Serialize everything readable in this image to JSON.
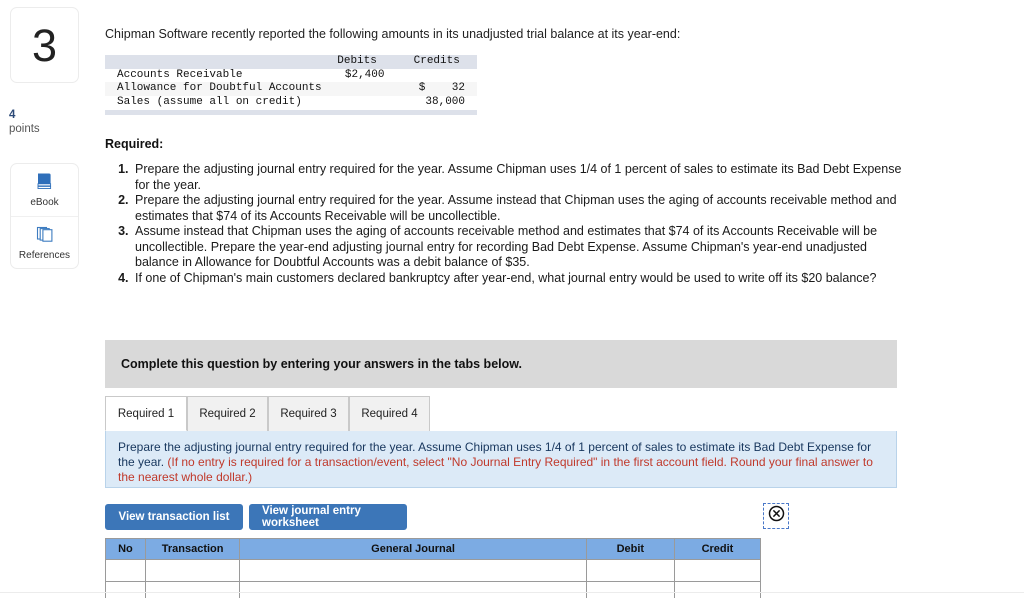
{
  "sidebar": {
    "question_number": "3",
    "points_value": "4",
    "points_label": "points",
    "tools": [
      {
        "label": "eBook",
        "icon": "book-icon"
      },
      {
        "label": "References",
        "icon": "pages-icon"
      }
    ]
  },
  "main": {
    "intro": "Chipman Software recently reported the following amounts in its unadjusted trial balance at its year-end:",
    "trial_balance": {
      "columns": [
        "",
        "Debits",
        "Credits"
      ],
      "rows": [
        {
          "account": "Accounts Receivable",
          "debit": "$2,400",
          "credit_symbol": "",
          "credit": ""
        },
        {
          "account": "Allowance for Doubtful Accounts",
          "debit": "",
          "credit_symbol": "$",
          "credit": "32"
        },
        {
          "account": "Sales (assume all on credit)",
          "debit": "",
          "credit_symbol": "",
          "credit": "38,000"
        }
      ]
    },
    "required_heading": "Required:",
    "required_items": [
      "Prepare the adjusting journal entry required for the year. Assume Chipman uses 1/4 of 1 percent of sales to estimate its Bad Debt Expense for the year.",
      "Prepare the adjusting journal entry required for the year. Assume instead that Chipman uses the aging of accounts receivable method and estimates that $74 of its Accounts Receivable will be uncollectible.",
      "Assume instead that Chipman uses the aging of accounts receivable method and estimates that $74 of its Accounts Receivable will be uncollectible. Prepare the year-end adjusting journal entry for recording Bad Debt Expense. Assume Chipman's year-end unadjusted balance in Allowance for Doubtful Accounts was a debit balance of $35.",
      "If one of Chipman's main customers declared bankruptcy after year-end, what journal entry would be used to write off its $20 balance?"
    ],
    "banner_text": "Complete this question by entering your answers in the tabs below.",
    "tabs": [
      {
        "label": "Required 1",
        "active": true
      },
      {
        "label": "Required 2",
        "active": false
      },
      {
        "label": "Required 3",
        "active": false
      },
      {
        "label": "Required 4",
        "active": false
      }
    ],
    "instruction": {
      "main": "Prepare the adjusting journal entry required for the year. Assume Chipman uses 1/4 of 1 percent of sales to estimate its Bad Debt Expense for the year. ",
      "note": "(If no entry is required for a transaction/event, select \"No Journal Entry Required\" in the first account field. Round your final answer to the nearest whole dollar.)"
    },
    "buttons": {
      "transaction_list": "View transaction list",
      "journal_worksheet": "View journal entry worksheet"
    },
    "close_icon": "close-circle-icon",
    "journal_table": {
      "headers": [
        "No",
        "Transaction",
        "General Journal",
        "Debit",
        "Credit"
      ],
      "rows": [
        {
          "no": "",
          "transaction": "",
          "general_journal": "",
          "debit": "",
          "credit": ""
        },
        {
          "no": "",
          "transaction": "",
          "general_journal": "",
          "debit": "",
          "credit": ""
        }
      ]
    }
  },
  "colors": {
    "primary_button": "#3c76b8",
    "table_header": "#7cabe3",
    "instruction_bg": "#dceaf7",
    "note_text": "#c0392b",
    "banner_bg": "#d9d9d9"
  }
}
